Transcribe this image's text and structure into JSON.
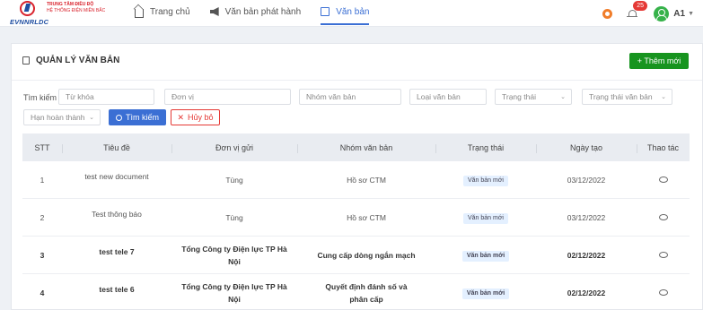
{
  "brand": {
    "org_line1": "TRUNG TÂM ĐIỀU ĐỘ",
    "org_line2": "HỆ THỐNG ĐIỆN MIỀN BẮC",
    "name": "EVNNRLDC"
  },
  "nav": [
    {
      "label": "Trang chủ",
      "icon": "home-icon",
      "active": false
    },
    {
      "label": "Văn bản phát hành",
      "icon": "megaphone-icon",
      "active": false
    },
    {
      "label": "Văn bản",
      "icon": "book-icon",
      "active": true
    }
  ],
  "header": {
    "notification_count": "25",
    "user": "A1",
    "help_icon": "lifebuoy-icon",
    "avatar_color": "#36b24a"
  },
  "page": {
    "title": "QUẢN LÝ VĂN BẢN",
    "add_button": "+ Thêm mới"
  },
  "filters": {
    "label": "Tìm kiếm :",
    "keyword_placeholder": "Từ khóa",
    "unit_placeholder": "Đơn vị",
    "group_placeholder": "Nhóm văn bản",
    "type_placeholder": "Loại văn bản",
    "status_placeholder": "Trạng thái",
    "doc_status_placeholder": "Trạng thái văn bản",
    "deadline_placeholder": "Hạn hoàn thành",
    "search_button": "Tìm kiếm",
    "cancel_button": "Hủy bỏ"
  },
  "table": {
    "columns": [
      "STT",
      "Tiêu đề",
      "Đơn vị gửi",
      "Nhóm văn bản",
      "Trạng thái",
      "Ngày tạo",
      "Thao tác"
    ],
    "rows": [
      {
        "stt": "1",
        "title": "test new document",
        "unit": "Tùng",
        "group": "Hồ sơ CTM",
        "status": "Văn bản mới",
        "date": "03/12/2022",
        "bold": false
      },
      {
        "stt": "2",
        "title": "Test thông báo",
        "unit": "Tùng",
        "group": "Hồ sơ CTM",
        "status": "Văn bản mới",
        "date": "03/12/2022",
        "bold": false
      },
      {
        "stt": "3",
        "title": "test tele 7",
        "unit": "Tổng Công ty Điện lực TP Hà Nội",
        "group": "Cung cấp dòng ngắn mạch",
        "status": "Văn bản mới",
        "date": "02/12/2022",
        "bold": true
      },
      {
        "stt": "4",
        "title": "test tele 6",
        "unit": "Tổng Công ty Điện lực TP Hà Nội",
        "group": "Quyết định đánh số và phân cấp",
        "status": "Văn bản mới",
        "date": "02/12/2022",
        "bold": true
      }
    ]
  },
  "colors": {
    "primary": "#3b6fd4",
    "success": "#17941f",
    "danger": "#e53935"
  }
}
